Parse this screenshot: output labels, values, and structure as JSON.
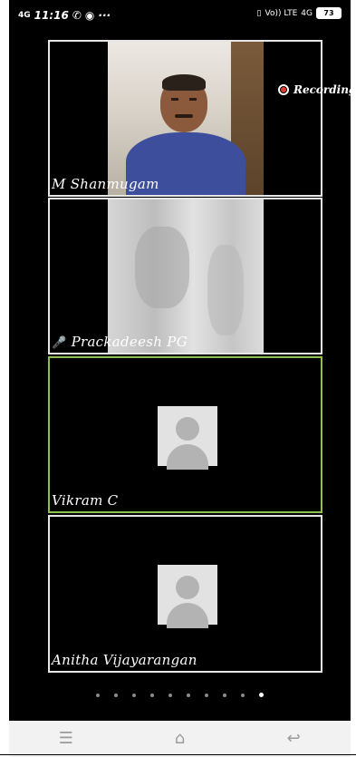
{
  "status_bar": {
    "network": "4G",
    "time": "11:16",
    "volte": "Vo)) LTE",
    "network_right": "4G",
    "battery": "73"
  },
  "recording": {
    "label": "Recording"
  },
  "participants": [
    {
      "name": "M Shanmugam",
      "video": "on"
    },
    {
      "name": "Prackadeesh PG",
      "video": "blurred",
      "muted": true
    },
    {
      "name": "Vikram C",
      "video": "off",
      "active_speaker": true
    },
    {
      "name": "Anitha Vijayarangan",
      "video": "off"
    }
  ],
  "pager": {
    "total": 10,
    "current": 10
  },
  "nav": {
    "icons": [
      "menu-icon",
      "home-icon",
      "back-icon"
    ]
  },
  "colors": {
    "active_border": "#8cc152",
    "record_red": "#e53935"
  }
}
